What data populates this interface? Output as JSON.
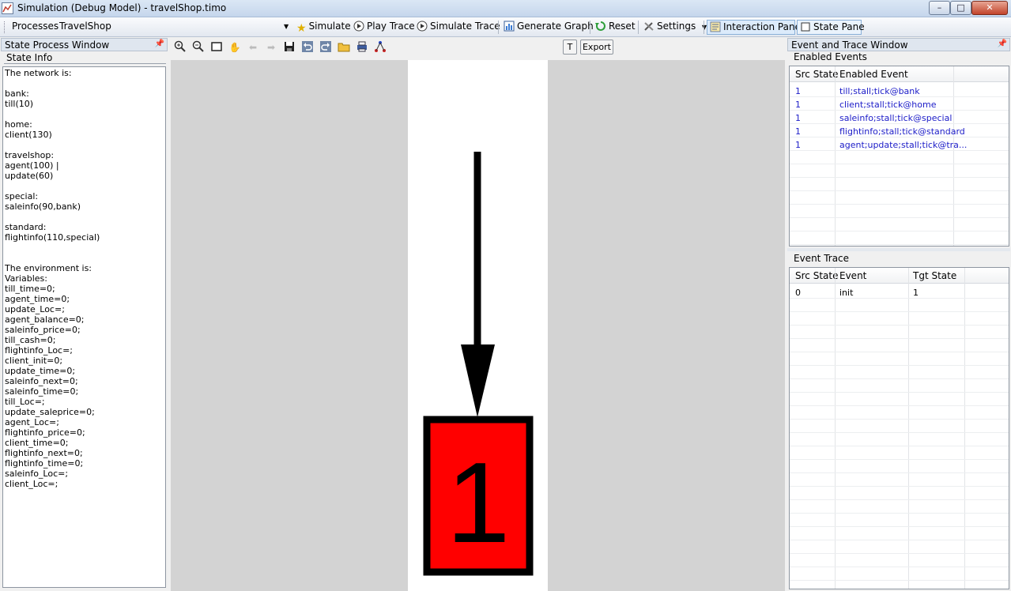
{
  "window": {
    "title": "Simulation (Debug Model) - travelShop.timo",
    "minimize": "–",
    "maximize": "□",
    "close": "✕"
  },
  "toolbar": {
    "processes_label": "Processes",
    "process_value": "TravelShop",
    "simulate": "Simulate",
    "play_trace": "Play Trace",
    "simulate_trace": "Simulate Trace",
    "generate_graph": "Generate Graph",
    "reset": "Reset",
    "settings": "Settings",
    "interaction_pane": "Interaction Pane",
    "state_pane": "State Pane"
  },
  "left_panel": {
    "title": "State Process Window",
    "tab": "State Info",
    "content": "The network is:\n\nbank:\ntill(10)\n\nhome:\nclient(130)\n\ntravelshop:\nagent(100) |\nupdate(60)\n\nspecial:\nsaleinfo(90,bank)\n\nstandard:\nflightinfo(110,special)\n\n\nThe environment is:\nVariables:\ntill_time=0;\nagent_time=0;\nupdate_Loc=;\nagent_balance=0;\nsaleinfo_price=0;\ntill_cash=0;\nflightinfo_Loc=;\nclient_init=0;\nupdate_time=0;\nsaleinfo_next=0;\nsaleinfo_time=0;\ntill_Loc=;\nupdate_saleprice=0;\nagent_Loc=;\nflightinfo_price=0;\nclient_time=0;\nflightinfo_next=0;\nflightinfo_time=0;\nsaleinfo_Loc=;\nclient_Loc=;"
  },
  "graph_toolbar": {
    "t_button": "T",
    "export_button": "Export"
  },
  "graph": {
    "node_label": "1",
    "node_fill": "#ff0000"
  },
  "right_panel": {
    "title": "Event and Trace Window",
    "enabled_events": {
      "label": "Enabled Events",
      "columns": [
        "Src State",
        "Enabled Event"
      ],
      "rows": [
        [
          "1",
          "till;stall;tick@bank"
        ],
        [
          "1",
          "client;stall;tick@home"
        ],
        [
          "1",
          "saleinfo;stall;tick@special"
        ],
        [
          "1",
          "flightinfo;stall;tick@standard"
        ],
        [
          "1",
          "agent;update;stall;tick@tra..."
        ]
      ]
    },
    "event_trace": {
      "label": "Event Trace",
      "columns": [
        "Src State",
        "Event",
        "Tgt State"
      ],
      "rows": [
        [
          "0",
          "init",
          "1"
        ]
      ]
    }
  }
}
